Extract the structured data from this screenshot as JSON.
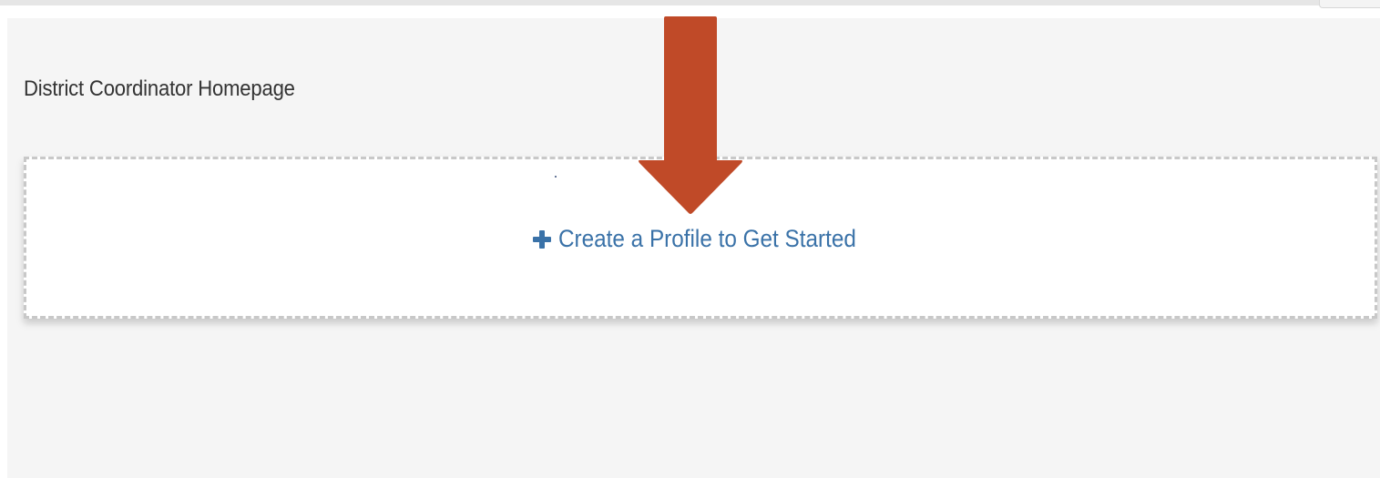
{
  "page": {
    "title": "District Coordinator Homepage"
  },
  "dropzone": {
    "action_label": "Create a Profile to Get Started",
    "action_icon": "plus-icon"
  },
  "annotation": {
    "icon": "down-arrow-icon",
    "color": "#C04A28"
  },
  "colors": {
    "link": "#3A72A8",
    "page_background": "#F5F5F5",
    "dashed_border": "#C8C8C8"
  }
}
